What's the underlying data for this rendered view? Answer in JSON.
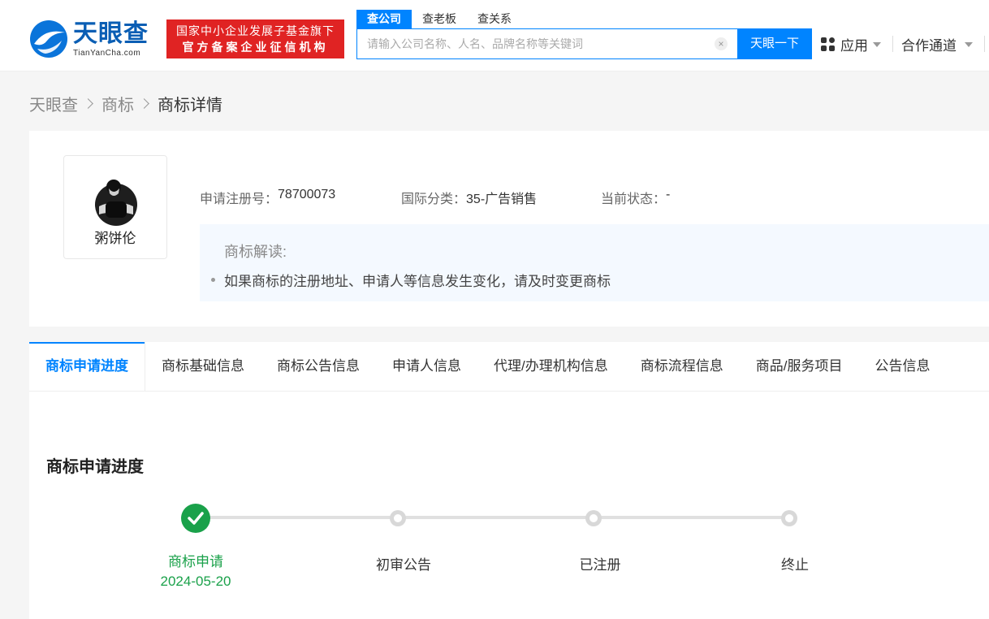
{
  "header": {
    "logo_cn": "天眼查",
    "logo_en": "TianYanCha.com",
    "badge_line1": "国家中小企业发展子基金旗下",
    "badge_line2": "官方备案企业征信机构",
    "search_tabs": [
      "查公司",
      "查老板",
      "查关系"
    ],
    "search_placeholder": "请输入公司名称、人名、品牌名称等关键词",
    "clear_icon": "×",
    "search_button": "天眼一下",
    "nav_apps": "应用",
    "nav_coop": "合作通道"
  },
  "breadcrumb": [
    "天眼查",
    "商标",
    "商标详情"
  ],
  "trademark": {
    "image_label": "粥饼伦",
    "reg_no_label": "申请注册号：",
    "reg_no": "78700073",
    "intl_class_label": "国际分类：",
    "intl_class": "35-广告销售",
    "status_label": "当前状态：",
    "status": "-",
    "interp_title": "商标解读:",
    "interp_item": "如果商标的注册地址、申请人等信息发生变化，请及时变更商标"
  },
  "tabs": [
    "商标申请进度",
    "商标基础信息",
    "商标公告信息",
    "申请人信息",
    "代理/办理机构信息",
    "商标流程信息",
    "商品/服务项目",
    "公告信息"
  ],
  "progress": {
    "title": "商标申请进度",
    "steps": [
      {
        "label": "商标申请",
        "date": "2024-05-20",
        "done": true
      },
      {
        "label": "初审公告",
        "done": false
      },
      {
        "label": "已注册",
        "done": false
      },
      {
        "label": "终止",
        "done": false
      }
    ]
  },
  "colors": {
    "accent": "#0084ff",
    "badge": "#e02323",
    "success": "#1aa14a"
  }
}
